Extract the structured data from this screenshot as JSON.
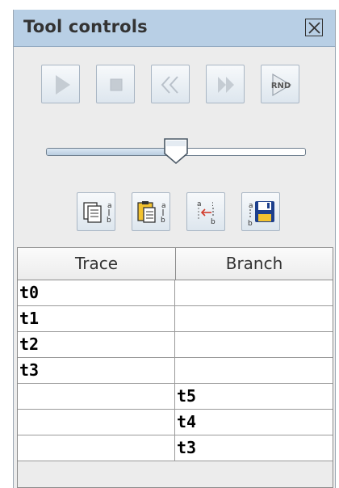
{
  "panel": {
    "title": "Tool controls",
    "close_icon": "close-box-icon"
  },
  "playback": {
    "buttons": [
      {
        "name": "play-button",
        "icon": "play-icon",
        "enabled": false
      },
      {
        "name": "stop-button",
        "icon": "stop-icon",
        "enabled": false
      },
      {
        "name": "rewind-button",
        "icon": "rewind-icon",
        "enabled": false
      },
      {
        "name": "fast-forward-button",
        "icon": "fast-forward-icon",
        "enabled": false
      },
      {
        "name": "random-button",
        "icon": "random-step-icon",
        "label": "RND",
        "enabled": true
      }
    ]
  },
  "slider": {
    "value_fraction": 0.5
  },
  "tools": {
    "buttons": [
      {
        "name": "copy-trace-button",
        "icon": "copy-document-icon"
      },
      {
        "name": "paste-trace-button",
        "icon": "paste-document-icon"
      },
      {
        "name": "branch-trace-button",
        "icon": "branch-arrow-icon"
      },
      {
        "name": "save-trace-button",
        "icon": "save-floppy-icon"
      }
    ]
  },
  "table": {
    "columns": [
      "Trace",
      "Branch"
    ],
    "rows": [
      [
        "t0",
        ""
      ],
      [
        "t1",
        ""
      ],
      [
        "t2",
        ""
      ],
      [
        "t3",
        ""
      ],
      [
        "",
        "t5"
      ],
      [
        "",
        "t4"
      ],
      [
        "",
        "t3"
      ]
    ]
  },
  "colors": {
    "title_bar": "#b8cfe5",
    "panel_bg": "#ececec",
    "icon_disabled": "#c5ccd3",
    "save_icon_blue": "#1d3f8c",
    "paste_icon_yellow": "#f2c230"
  }
}
